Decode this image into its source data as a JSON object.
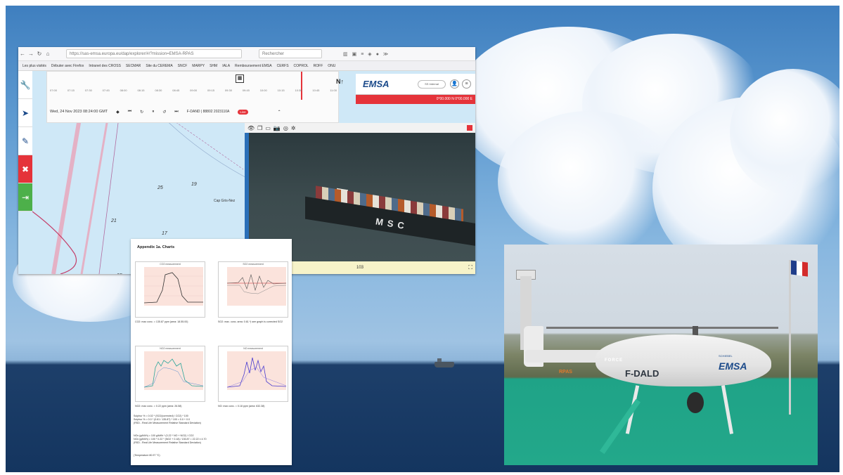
{
  "browser": {
    "url": "https://sas-emsa.europa.eu/dap/explorer/#/?mission=EMSA-RPAS",
    "search_placeholder": "Rechercher",
    "bookmarks": [
      "Les plus visités",
      "Débuter avec Firefox",
      "Intranet des CROSS",
      "SECMAR",
      "Site du CEREMA",
      "SNCF",
      "MARPY",
      "SHM",
      "IALA",
      "Remboursement EMSA",
      "CERFS",
      "COPROL",
      "ROFF",
      "ONU"
    ]
  },
  "timeline": {
    "ticks": [
      "07:00",
      "07:15",
      "07:30",
      "07:45",
      "08:00",
      "08:15",
      "08:30",
      "08:45",
      "09:00",
      "09:15",
      "09:30",
      "09:45",
      "10:00",
      "10:15",
      "10:30",
      "10:45",
      "11:00"
    ],
    "date_label": "Wed, 24 Nov 2023 08:24:00 GMT",
    "flight_label": "F-DAND | 88802 2023110A",
    "live_badge": "Live"
  },
  "emsa": {
    "logo": "EMSA",
    "pill": "SS Internal",
    "coords": "0°00.000 N 0°00.000 E"
  },
  "map": {
    "depths": [
      "25",
      "19",
      "17",
      "21",
      "25"
    ],
    "place": "Cap Gris-Nez"
  },
  "video": {
    "ship_name": "MSC",
    "footer_value": "103"
  },
  "appendix": {
    "title": "Appendix 1a. Charts",
    "charts": [
      {
        "title": "CO2 measurement",
        "caption": "CO2: max conc. = 135.87 ppm (area: 18.55.00)"
      },
      {
        "title": "SO2 measurement",
        "caption": "SO2: max. conc. area: 0.61 *) see graph is corrected SO2"
      },
      {
        "title": "NO2 measurement",
        "caption": "NO2: max conc. = 0.22 ppm (area: 26.58)"
      },
      {
        "title": "NO measurement",
        "caption": "NO: max conc. = 0.18 ppm (area: 632.38)"
      }
    ],
    "formula1": "Sulphur % = 0.02 * (SO2(corrected) / CO2) * 100",
    "formula1b": "Sulphur % = 0.0 * (0.61 / 135.87) * 100 = 0.0 + 0.0",
    "formula1c": "(RSD - Real Life Measurement Relative Standard Deviation)",
    "formula2": "NOx (g/kWh) = 100 g/kWh * (0.22 * NO + NO2) / CO2",
    "formula2b": "NOx (g/kWh) = 100 * 0.22 * (NO2 + 0.18) / 135.87 = 22.22 ± 4.70",
    "formula2c": "(RSD - Real Life Measurement Relative Standard Deviation)",
    "temperature": "(Temperature 80.97 °C)"
  },
  "drone": {
    "registration": "F-DALD",
    "logo": "EMSA",
    "force_text": "FORCE",
    "rpas_text": "RPAS",
    "brand": "SCHIEBEL"
  },
  "colors": {
    "emsa_blue": "#1b4a8a",
    "alert_red": "#e5333a",
    "sidebar_green": "#4db04a",
    "heli_pad_green": "#23a88a"
  }
}
